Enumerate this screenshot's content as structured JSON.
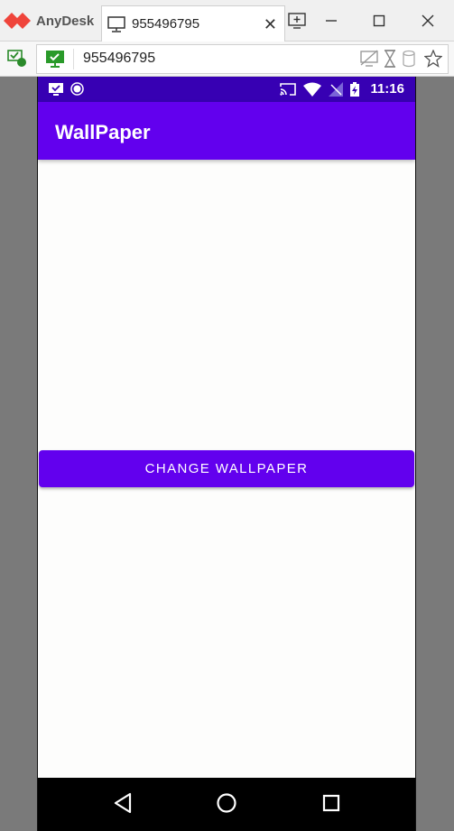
{
  "window": {
    "app_name": "AnyDesk",
    "tab_label": "955496795",
    "address": "955496795"
  },
  "status_bar": {
    "time": "11:16"
  },
  "app": {
    "title": "WallPaper",
    "button_label": "CHANGE WALLPAPER"
  },
  "colors": {
    "primary": "#6200ee",
    "primary_dark": "#3700b3",
    "anydesk_red": "#ef443b"
  }
}
